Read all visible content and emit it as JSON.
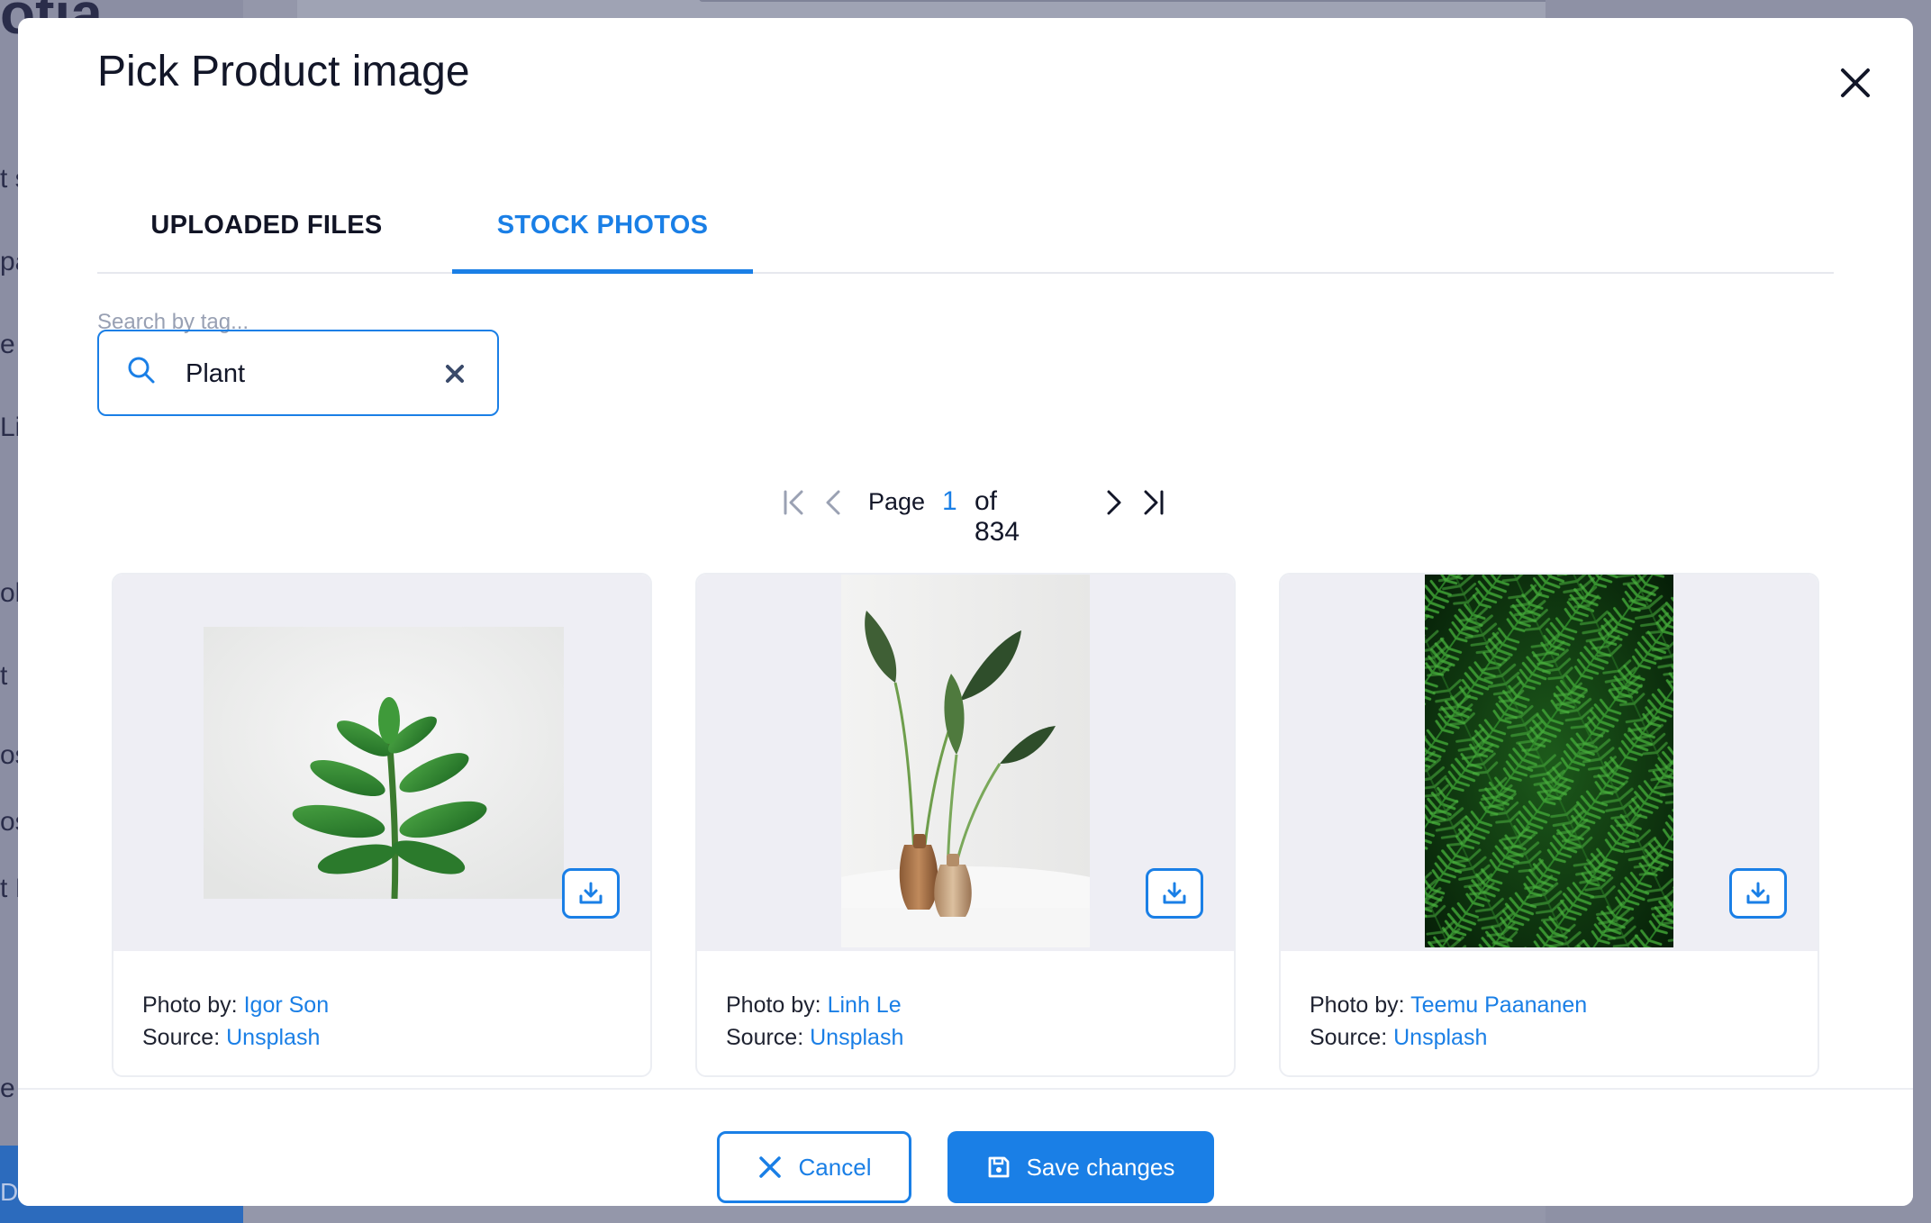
{
  "background": {
    "logo_fragment": "otia",
    "sidebar_fragments": [
      "t s",
      "pa",
      "e",
      "Li",
      "ol",
      "t",
      "os",
      "os",
      "t I",
      "e"
    ],
    "docs_label": "Docs"
  },
  "modal": {
    "title": "Pick Product image",
    "close_icon": "close-icon"
  },
  "tabs": [
    {
      "label": "UPLOADED FILES",
      "active": false
    },
    {
      "label": "STOCK PHOTOS",
      "active": true
    }
  ],
  "search": {
    "label": "Search by tag...",
    "value": "Plant",
    "icon": "search-icon",
    "clear_icon": "clear-icon"
  },
  "pagination": {
    "page_label": "Page",
    "current_page": "1",
    "total_label": "of 834",
    "icons": [
      "first-page-icon",
      "prev-page-icon",
      "next-page-icon",
      "last-page-icon"
    ]
  },
  "photos": [
    {
      "photo_by_label": "Photo by:",
      "author": "Igor Son",
      "source_label": "Source:",
      "source": "Unsplash",
      "icon": "download-icon"
    },
    {
      "photo_by_label": "Photo by:",
      "author": "Linh Le",
      "source_label": "Source:",
      "source": "Unsplash",
      "icon": "download-icon"
    },
    {
      "photo_by_label": "Photo by:",
      "author": "Teemu Paananen",
      "source_label": "Source:",
      "source": "Unsplash",
      "icon": "download-icon"
    }
  ],
  "footer": {
    "cancel_label": "Cancel",
    "save_label": "Save changes"
  },
  "colors": {
    "accent": "#1a7fe6",
    "text": "#121628",
    "muted": "#98a0b3",
    "card_bg": "#eeeef4"
  }
}
